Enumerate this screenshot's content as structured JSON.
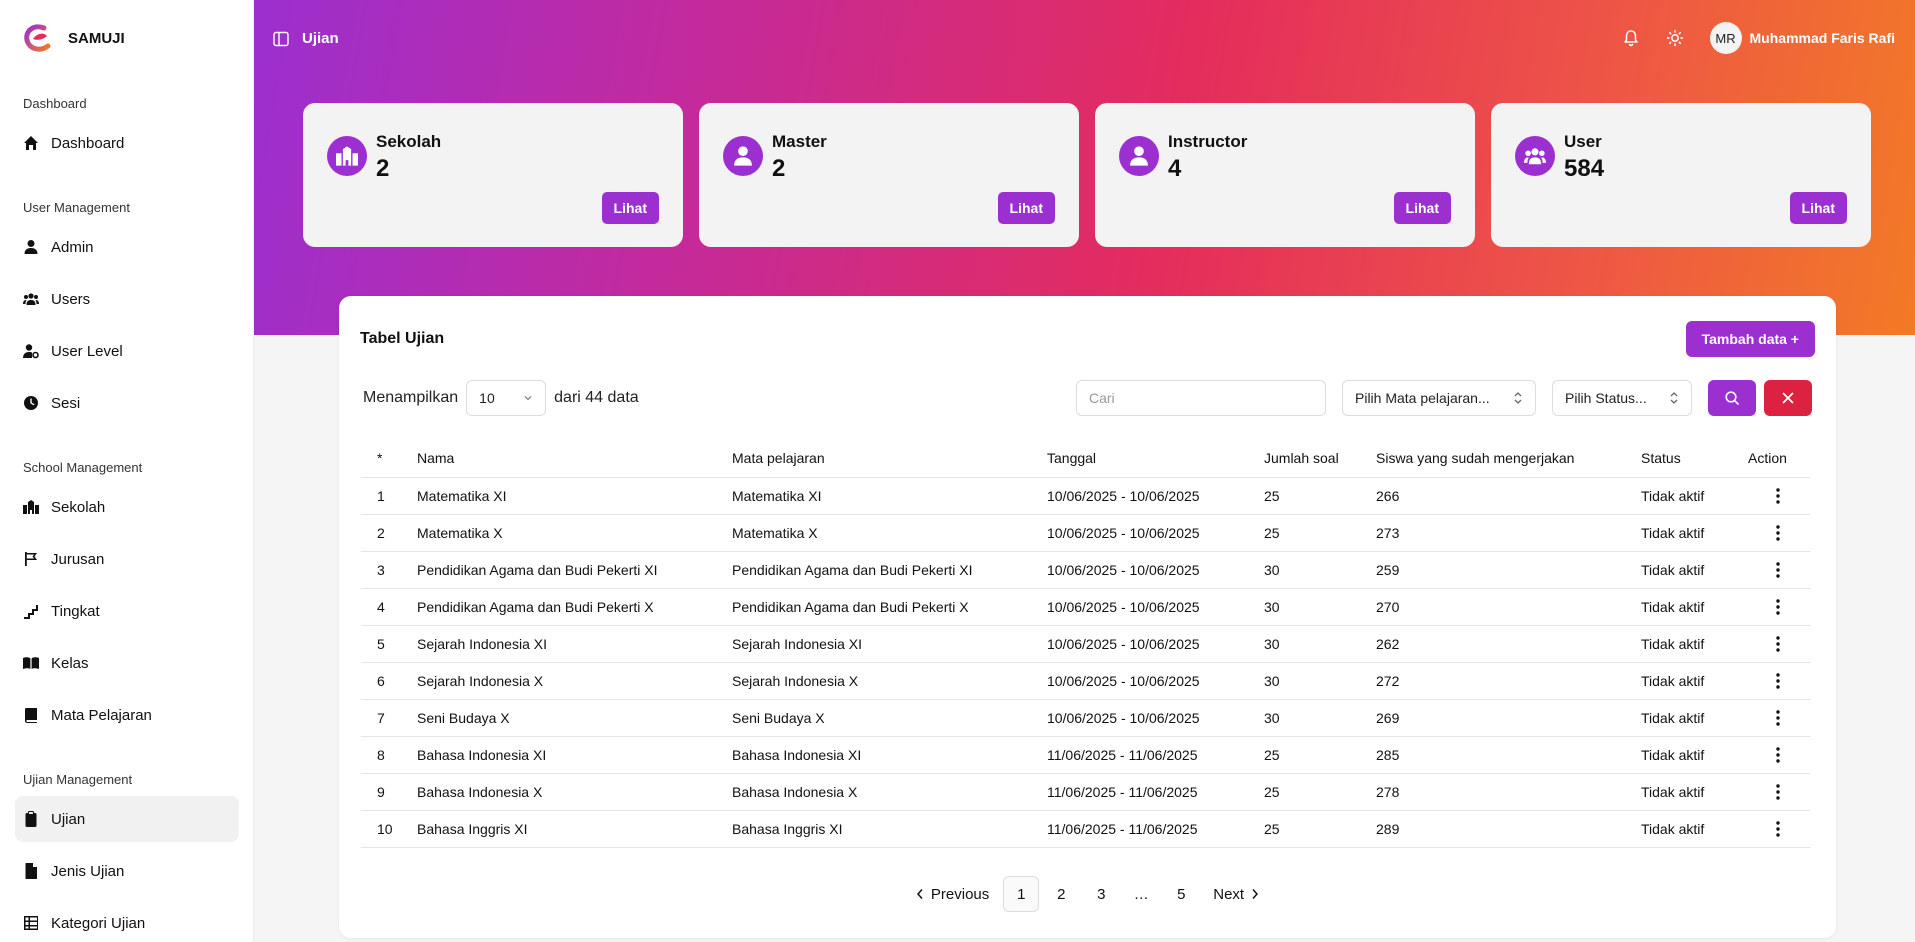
{
  "brand": {
    "name": "SAMUJI"
  },
  "sidebar": {
    "sections": [
      {
        "title": "Dashboard"
      },
      {
        "title": "User Management"
      },
      {
        "title": "School Management"
      },
      {
        "title": "Ujian Management"
      }
    ],
    "items": [
      {
        "label": "Dashboard",
        "icon": "home-icon"
      },
      {
        "label": "Admin",
        "icon": "user-icon"
      },
      {
        "label": "Users",
        "icon": "users-icon"
      },
      {
        "label": "User Level",
        "icon": "user-cog-icon"
      },
      {
        "label": "Sesi",
        "icon": "clock-icon"
      },
      {
        "label": "Sekolah",
        "icon": "school-icon"
      },
      {
        "label": "Jurusan",
        "icon": "flag-icon"
      },
      {
        "label": "Tingkat",
        "icon": "stairs-icon"
      },
      {
        "label": "Kelas",
        "icon": "book-open-icon"
      },
      {
        "label": "Mata Pelajaran",
        "icon": "book-icon"
      },
      {
        "label": "Ujian",
        "icon": "clipboard-icon",
        "active": true
      },
      {
        "label": "Jenis Ujian",
        "icon": "file-icon"
      },
      {
        "label": "Kategori Ujian",
        "icon": "grid-icon"
      }
    ]
  },
  "header": {
    "title": "Ujian",
    "user_initials": "MR",
    "user_name": "Muhammad Faris Rafi"
  },
  "stats": [
    {
      "label": "Sekolah",
      "value": "2",
      "button": "Lihat",
      "icon": "school-icon"
    },
    {
      "label": "Master",
      "value": "2",
      "button": "Lihat",
      "icon": "user-icon"
    },
    {
      "label": "Instructor",
      "value": "4",
      "button": "Lihat",
      "icon": "user-icon"
    },
    {
      "label": "User",
      "value": "584",
      "button": "Lihat",
      "icon": "users-icon"
    }
  ],
  "table_panel": {
    "title": "Tabel Ujian",
    "add_button": "Tambah data +",
    "show_label": "Menampilkan",
    "per_page": "10",
    "total_label": "dari 44 data",
    "search_placeholder": "Cari",
    "subject_filter": "Pilih Mata pelajaran...",
    "status_filter": "Pilih Status...",
    "columns": [
      "*",
      "Nama",
      "Mata pelajaran",
      "Tanggal",
      "Jumlah soal",
      "Siswa yang sudah mengerjakan",
      "Status",
      "Action"
    ],
    "rows": [
      [
        "1",
        "Matematika XI",
        "Matematika XI",
        "10/06/2025 - 10/06/2025",
        "25",
        "266",
        "Tidak aktif"
      ],
      [
        "2",
        "Matematika X",
        "Matematika X",
        "10/06/2025 - 10/06/2025",
        "25",
        "273",
        "Tidak aktif"
      ],
      [
        "3",
        "Pendidikan Agama dan Budi Pekerti XI",
        "Pendidikan Agama dan Budi Pekerti XI",
        "10/06/2025 - 10/06/2025",
        "30",
        "259",
        "Tidak aktif"
      ],
      [
        "4",
        "Pendidikan Agama dan Budi Pekerti X",
        "Pendidikan Agama dan Budi Pekerti X",
        "10/06/2025 - 10/06/2025",
        "30",
        "270",
        "Tidak aktif"
      ],
      [
        "5",
        "Sejarah Indonesia XI",
        "Sejarah Indonesia XI",
        "10/06/2025 - 10/06/2025",
        "30",
        "262",
        "Tidak aktif"
      ],
      [
        "6",
        "Sejarah Indonesia X",
        "Sejarah Indonesia X",
        "10/06/2025 - 10/06/2025",
        "30",
        "272",
        "Tidak aktif"
      ],
      [
        "7",
        "Seni Budaya X",
        "Seni Budaya X",
        "10/06/2025 - 10/06/2025",
        "30",
        "269",
        "Tidak aktif"
      ],
      [
        "8",
        "Bahasa Indonesia XI",
        "Bahasa Indonesia XI",
        "11/06/2025 - 11/06/2025",
        "25",
        "285",
        "Tidak aktif"
      ],
      [
        "9",
        "Bahasa Indonesia X",
        "Bahasa Indonesia X",
        "11/06/2025 - 11/06/2025",
        "25",
        "278",
        "Tidak aktif"
      ],
      [
        "10",
        "Bahasa Inggris XI",
        "Bahasa Inggris XI",
        "11/06/2025 - 11/06/2025",
        "25",
        "289",
        "Tidak aktif"
      ]
    ]
  },
  "pagination": {
    "previous": "Previous",
    "next": "Next",
    "pages": [
      "1",
      "2",
      "3",
      "…",
      "5"
    ],
    "current": "1"
  },
  "colors": {
    "accent": "#9b2fcf",
    "danger": "#dc2240"
  }
}
